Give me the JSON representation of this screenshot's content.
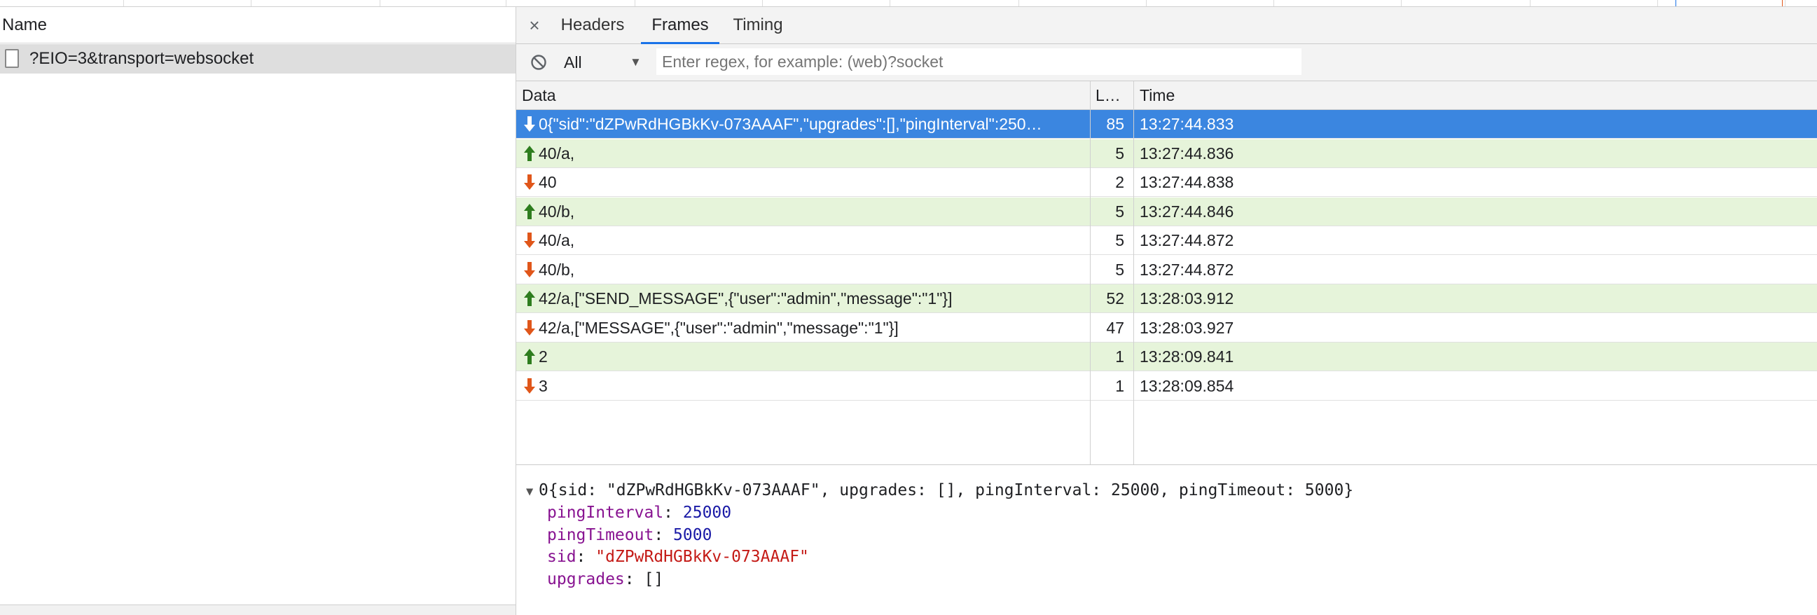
{
  "left_panel": {
    "header_label": "Name",
    "request_label": "?EIO=3&transport=websocket"
  },
  "tabs": {
    "close_glyph": "×",
    "headers": "Headers",
    "frames": "Frames",
    "timing": "Timing"
  },
  "filter": {
    "selected": "All",
    "placeholder": "Enter regex, for example: (web)?socket",
    "value": ""
  },
  "columns": {
    "data": "Data",
    "length": "L…",
    "time": "Time"
  },
  "frames": [
    {
      "direction": "received",
      "data": "0{\"sid\":\"dZPwRdHGBkKv-073AAAF\",\"upgrades\":[],\"pingInterval\":250…",
      "length": "85",
      "time": "13:27:44.833",
      "selected": true
    },
    {
      "direction": "sent",
      "data": "40/a,",
      "length": "5",
      "time": "13:27:44.836"
    },
    {
      "direction": "received",
      "data": "40",
      "length": "2",
      "time": "13:27:44.838"
    },
    {
      "direction": "sent",
      "data": "40/b,",
      "length": "5",
      "time": "13:27:44.846"
    },
    {
      "direction": "received",
      "data": "40/a,",
      "length": "5",
      "time": "13:27:44.872"
    },
    {
      "direction": "received",
      "data": "40/b,",
      "length": "5",
      "time": "13:27:44.872"
    },
    {
      "direction": "sent",
      "data": "42/a,[\"SEND_MESSAGE\",{\"user\":\"admin\",\"message\":\"1\"}]",
      "length": "52",
      "time": "13:28:03.912"
    },
    {
      "direction": "received",
      "data": "42/a,[\"MESSAGE\",{\"user\":\"admin\",\"message\":\"1\"}]",
      "length": "47",
      "time": "13:28:03.927"
    },
    {
      "direction": "sent",
      "data": "2",
      "length": "1",
      "time": "13:28:09.841"
    },
    {
      "direction": "received",
      "data": "3",
      "length": "1",
      "time": "13:28:09.854"
    }
  ],
  "preview": {
    "summary": "0{sid: \"dZPwRdHGBkKv-073AAAF\", upgrades: [], pingInterval: 25000, pingTimeout: 5000}",
    "props": [
      {
        "key": "pingInterval",
        "sep": ": ",
        "value": "25000",
        "type": "number"
      },
      {
        "key": "pingTimeout",
        "sep": ": ",
        "value": "5000",
        "type": "number"
      },
      {
        "key": "sid",
        "sep": ": ",
        "value": "\"dZPwRdHGBkKv-073AAAF\"",
        "type": "string"
      },
      {
        "key": "upgrades",
        "sep": ": ",
        "value": "[]",
        "type": "plain"
      }
    ]
  },
  "colors": {
    "accent": "#1a73e8",
    "selected_row": "#3b86e0",
    "sent_row": "#e6f4da",
    "sent_arrow": "#2e7d1e",
    "received_arrow": "#e0561a",
    "received_arrow_selected": "#ffffff"
  },
  "icons": {
    "clear": "block-icon",
    "filter_dropdown": "chevron-down-icon",
    "sent": "arrow-up-icon",
    "received": "arrow-down-icon",
    "request": "file-icon",
    "expand": "triangle-down-icon"
  }
}
